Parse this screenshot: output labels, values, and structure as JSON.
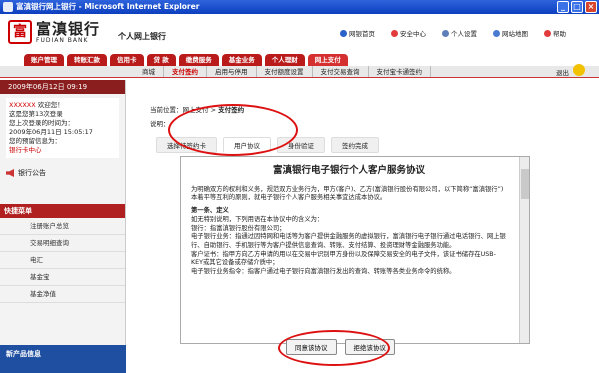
{
  "window": {
    "title": "富滇银行网上银行 - Microsoft Internet Explorer"
  },
  "header": {
    "bank_name": "富滇银行",
    "bank_name_en": "FUDIAN BANK",
    "site_title": "个人网上银行",
    "top_links": [
      "网银首页",
      "安全中心",
      "个人设置",
      "网站地图",
      "帮助"
    ]
  },
  "nav": {
    "tabs": [
      "账户管理",
      "转账汇款",
      "信用卡",
      "贷 款",
      "缴费服务",
      "基金业务",
      "个人理财",
      "网上支付"
    ],
    "active_tab": "网上支付",
    "sub_items": [
      "商城",
      "支付签约",
      "启用与停用",
      "支付额度设置",
      "支付交易查询",
      "支付宝卡通签约"
    ],
    "active_sub": "支付签约",
    "logout": "退出"
  },
  "sidebar": {
    "date": "2009年06月12日 09:19",
    "user_name": "XXXXXX",
    "welcome": "欢迎您！",
    "login_info": [
      "这是您第13次登录",
      "您上次登录的时间为：",
      "2009年06月11日 15:05:17",
      "您的预留信息为："
    ],
    "user_link": "银行卡中心",
    "notice": "银行公告",
    "quick_head": "快捷菜单",
    "quick_items": [
      "注册账户总览",
      "交易明细查询",
      "电汇",
      "基金宝",
      "基金净值"
    ],
    "new_product": "新产品信息"
  },
  "main": {
    "breadcrumb_prefix": "当前位置：网上支付 > ",
    "breadcrumb_current": "支付签约",
    "desc_label": "说明：",
    "steps": [
      "选择待签约卡",
      "用户协议",
      "身份验证",
      "签约完成"
    ],
    "active_step": "用户协议",
    "agreement_title": "富滇银行电子银行个人客户服务协议",
    "agreement_paragraphs": [
      "为明确双方的权利和义务，规范双方业务行为，甲方(客户)、乙方(富滇银行股份有限公司，以下简称“富滇银行”)本着平等互利的原则，就电子银行个人客户服务相关事宜达成本协议。",
      "第一条、定义",
      "如无特别说明，下列用语在本协议中的含义为：",
      "银行：指富滇银行股份有限公司；",
      "电子银行业务：指通过因特网和电话等为客户提供金融服务的虚拟银行，富滇银行电子银行通过电话银行、网上银行、自助银行、手机银行等为客户提供信息查询、转账、支付结算、投资理财等金融服务功能。",
      "客户证书：指甲方向乙方申请的用以在交易中识别甲方身份以及保障交易安全的电子文件，该证书储存在USB-KEY或其它设备或存储介质中；",
      "电子银行业务指令：指客户通过电子银行向富滇银行发出的查询、转账等各类业务命令的统称。"
    ],
    "agree_button": "同意该协议",
    "reject_button": "拒绝该协议"
  }
}
